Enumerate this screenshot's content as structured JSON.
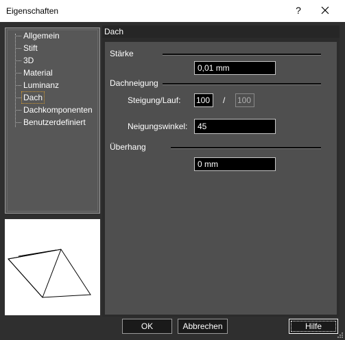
{
  "window": {
    "title": "Eigenschaften",
    "help_label": "?"
  },
  "tree": {
    "items": [
      {
        "label": "Allgemein"
      },
      {
        "label": "Stift"
      },
      {
        "label": "3D"
      },
      {
        "label": "Material"
      },
      {
        "label": "Luminanz"
      },
      {
        "label": "Dach",
        "selected": true
      },
      {
        "label": "Dachkomponenten"
      },
      {
        "label": "Benutzerdefiniert"
      }
    ]
  },
  "panel": {
    "header": "Dach",
    "staerke": {
      "label": "Stärke",
      "value": "0,01 mm"
    },
    "dachneigung": {
      "label": "Dachneigung",
      "steigung_label": "Steigung/Lauf:",
      "steigung_value": "100",
      "slash": "/",
      "lauf_value": "100",
      "neigungswinkel_label": "Neigungswinkel:",
      "neigungswinkel_value": "45"
    },
    "ueberhang": {
      "label": "Überhang",
      "value": "0 mm"
    }
  },
  "buttons": {
    "ok": "OK",
    "cancel": "Abbrechen",
    "help": "Hilfe"
  },
  "colors": {
    "selection_outline": "#d59b32",
    "background": "#2f2f2f",
    "panel": "#4f4f4f"
  }
}
